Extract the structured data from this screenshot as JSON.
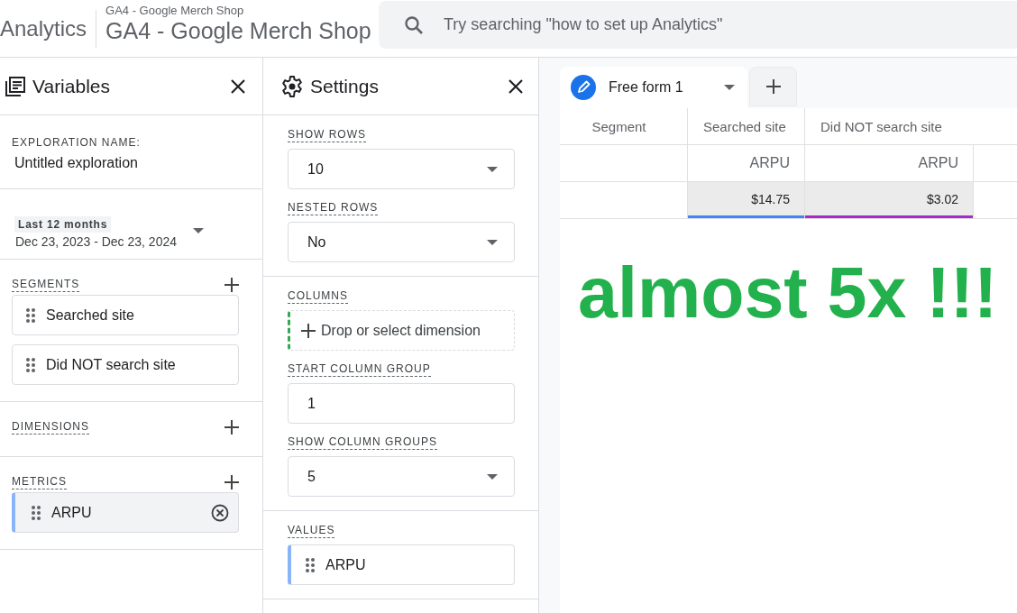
{
  "header": {
    "product": "Analytics",
    "property_small": "GA4 - Google Merch Shop",
    "property": "GA4 - Google Merch Shop",
    "search": {
      "placeholder": "Try searching \"how to set up Analytics\""
    }
  },
  "variables": {
    "title": "Variables",
    "exploration_name_label": "EXPLORATION NAME:",
    "exploration_name": "Untitled exploration",
    "date_range": {
      "preset": "Last 12 months",
      "range": "Dec 23, 2023 - Dec 23, 2024"
    },
    "sections": [
      {
        "title": "SEGMENTS",
        "kind": "segment",
        "items": [
          {
            "label": "Searched site"
          },
          {
            "label": "Did NOT search site"
          }
        ]
      },
      {
        "title": "DIMENSIONS",
        "kind": "dimension"
      },
      {
        "title": "METRICS",
        "kind": "metric",
        "items": [
          {
            "label": "ARPU"
          }
        ]
      }
    ]
  },
  "settings": {
    "title": "Settings",
    "groups": [
      {
        "fields": [
          {
            "kind": "dropdown",
            "label": "SHOW ROWS",
            "value": "10"
          },
          {
            "kind": "dropdown",
            "label": "NESTED ROWS",
            "value": "No"
          }
        ]
      },
      {
        "fields": [
          {
            "kind": "drop_zone",
            "label": "COLUMNS",
            "placeholder": "Drop or select dimension"
          },
          {
            "kind": "input",
            "label": "START COLUMN GROUP",
            "value": "1"
          },
          {
            "kind": "dropdown",
            "label": "SHOW COLUMN GROUPS",
            "value": "5"
          }
        ]
      },
      {
        "fields": [
          {
            "kind": "chip",
            "label": "VALUES",
            "value": "ARPU"
          }
        ]
      }
    ]
  },
  "canvas": {
    "tabs": [
      {
        "label": "Free form 1",
        "selected": true
      }
    ],
    "table": {
      "header_label": "Segment",
      "columns": [
        {
          "name": "Searched site",
          "metric": "ARPU",
          "value": "$14.75",
          "color": "#4285f4"
        },
        {
          "name": "Did NOT search site",
          "metric": "ARPU",
          "value": "$3.02",
          "color": "#a62bc9"
        }
      ]
    },
    "annotation": "almost 5x !!!"
  }
}
